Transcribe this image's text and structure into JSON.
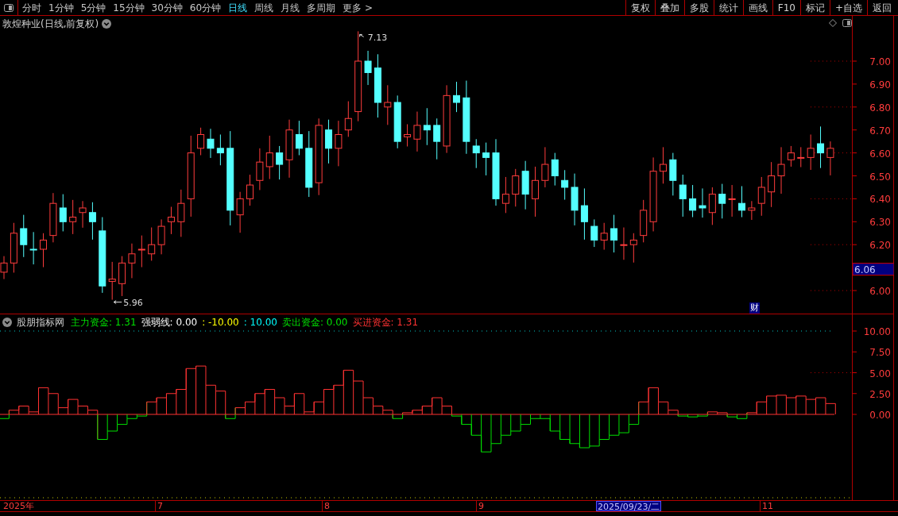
{
  "toolbar": {
    "periods": [
      {
        "label": "分时",
        "selected": false
      },
      {
        "label": "1分钟",
        "selected": false
      },
      {
        "label": "5分钟",
        "selected": false
      },
      {
        "label": "15分钟",
        "selected": false
      },
      {
        "label": "30分钟",
        "selected": false
      },
      {
        "label": "60分钟",
        "selected": false
      },
      {
        "label": "日线",
        "selected": true
      },
      {
        "label": "周线",
        "selected": false
      },
      {
        "label": "月线",
        "selected": false
      },
      {
        "label": "多周期",
        "selected": false
      },
      {
        "label": "更多 >",
        "selected": false
      }
    ],
    "buttons": [
      "复权",
      "叠加",
      "多股",
      "统计",
      "画线",
      "F10",
      "标记",
      "+自选",
      "返回"
    ]
  },
  "chart": {
    "title": "敦煌种业(日线,前复权)",
    "high_label": "7.13",
    "low_label": "5.96",
    "current_price": "6.06",
    "event_marker": "财",
    "price_ticks": [
      "7.00",
      "6.90",
      "6.80",
      "6.70",
      "6.60",
      "6.50",
      "6.40",
      "6.30",
      "6.20",
      "6.00"
    ]
  },
  "indicator": {
    "name": "股朋指标网",
    "legend": [
      {
        "text": "主力资金: 1.31",
        "color": "#00e000"
      },
      {
        "text": "强弱线: 0.00",
        "color": "#ffffff"
      },
      {
        "text": ": -10.00",
        "color": "#ffff00"
      },
      {
        "text": ": 10.00",
        "color": "#00ffff"
      },
      {
        "text": "卖出资金: 0.00",
        "color": "#00e000"
      },
      {
        "text": "买进资金: 1.31",
        "color": "#ff3232"
      }
    ],
    "ticks": [
      "10.00",
      "7.50",
      "5.00",
      "2.50",
      "0.00"
    ]
  },
  "time_axis": [
    {
      "label": "2025年",
      "selected": false
    },
    {
      "label": "7",
      "selected": false
    },
    {
      "label": "8",
      "selected": false
    },
    {
      "label": "9",
      "selected": false
    },
    {
      "label": "2025/09/23/二",
      "selected": true
    },
    {
      "label": "11",
      "selected": false
    }
  ]
}
